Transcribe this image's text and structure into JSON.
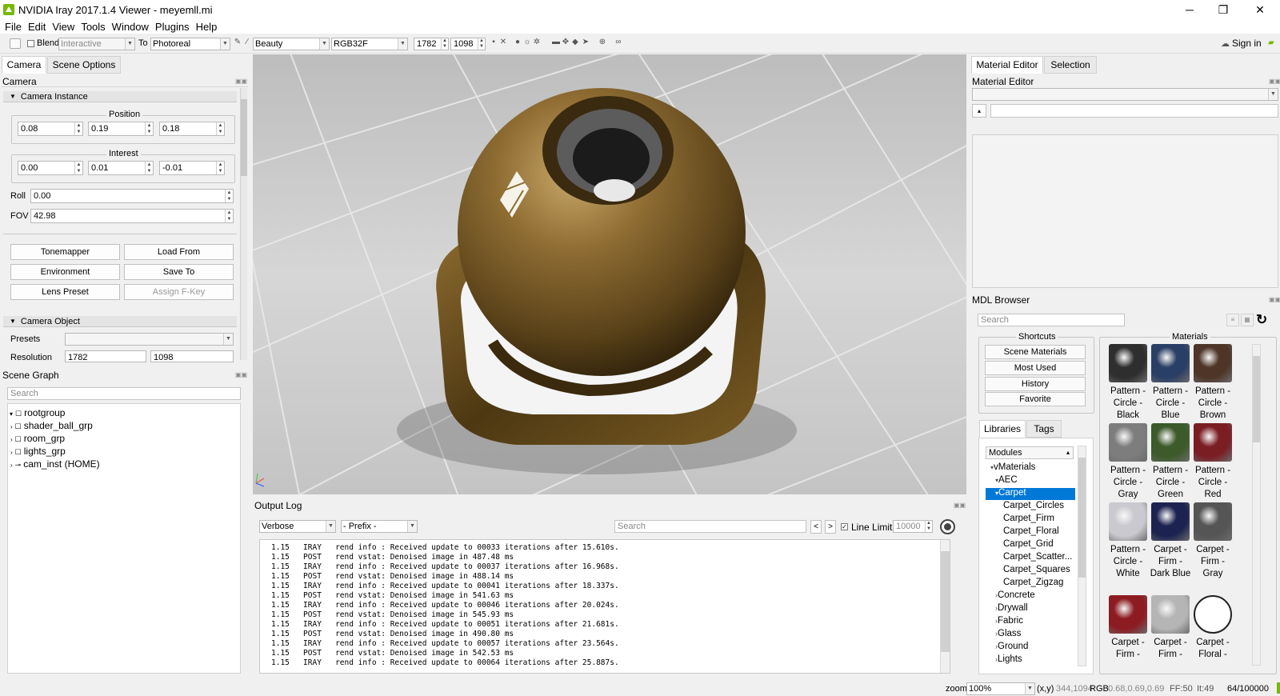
{
  "window": {
    "title": "NVIDIA Iray 2017.1.4 Viewer - meyemll.mi",
    "minimize": "─",
    "maximize": "❐",
    "close": "✕"
  },
  "menu": [
    "File",
    "Edit",
    "View",
    "Tools",
    "Window",
    "Plugins",
    "Help"
  ],
  "toolbar": {
    "blend_label": "Blend",
    "blend_mode": "Interactive",
    "to_label": "To",
    "to_mode": "Photoreal",
    "canvas": "Beauty",
    "pixel_format": "RGB32F",
    "width": "1782",
    "height": "1098",
    "sign_in": "Sign in"
  },
  "left_tabs": [
    "Camera",
    "Scene Options"
  ],
  "camera": {
    "panel_title": "Camera",
    "instance_header": "Camera Instance",
    "position_label": "Position",
    "position": [
      "0.08",
      "0.19",
      "0.18"
    ],
    "interest_label": "Interest",
    "interest": [
      "0.00",
      "0.01",
      "-0.01"
    ],
    "roll_label": "Roll",
    "roll": "0.00",
    "fov_label": "FOV",
    "fov": "42.98",
    "buttons": [
      "Tonemapper",
      "Load From",
      "Environment",
      "Save To",
      "Lens Preset",
      "Assign F-Key"
    ],
    "object_header": "Camera Object",
    "presets_label": "Presets",
    "resolution_label": "Resolution",
    "resolution": [
      "1782",
      "1098"
    ]
  },
  "scene_graph": {
    "title": "Scene Graph",
    "search_placeholder": "Search",
    "items": [
      "rootgroup",
      "shader_ball_grp",
      "room_grp",
      "lights_grp",
      "cam_inst (HOME)"
    ]
  },
  "output_log": {
    "title": "Output Log",
    "level": "Verbose",
    "prefix": "- Prefix -",
    "search_placeholder": "Search",
    "prev": "<",
    "next": ">",
    "line_limit_label": "Line Limit",
    "line_limit": "10000",
    "lines": [
      "1.15   IRAY   rend info : Received update to 00033 iterations after 15.610s.",
      "1.15   POST   rend vstat: Denoised image in 487.48 ms",
      "1.15   IRAY   rend info : Received update to 00037 iterations after 16.968s.",
      "1.15   POST   rend vstat: Denoised image in 488.14 ms",
      "1.15   IRAY   rend info : Received update to 00041 iterations after 18.337s.",
      "1.15   POST   rend vstat: Denoised image in 541.63 ms",
      "1.15   IRAY   rend info : Received update to 00046 iterations after 20.024s.",
      "1.15   POST   rend vstat: Denoised image in 545.93 ms",
      "1.15   IRAY   rend info : Received update to 00051 iterations after 21.681s.",
      "1.15   POST   rend vstat: Denoised image in 490.80 ms",
      "1.15   IRAY   rend info : Received update to 00057 iterations after 23.564s.",
      "1.15   POST   rend vstat: Denoised image in 542.53 ms",
      "1.15   IRAY   rend info : Received update to 00064 iterations after 25.887s."
    ]
  },
  "right_tabs": [
    "Material Editor",
    "Selection"
  ],
  "material_editor": {
    "title": "Material Editor",
    "expand": "▴"
  },
  "mdl_browser": {
    "title": "MDL Browser",
    "search_placeholder": "Search",
    "shortcuts_title": "Shortcuts",
    "shortcuts": [
      "Scene Materials",
      "Most Used",
      "History",
      "Favorite"
    ],
    "lib_tabs": [
      "Libraries",
      "Tags"
    ],
    "modules_label": "Modules",
    "tree": [
      {
        "text": "vMaterials",
        "arrow": "▾"
      },
      {
        "text": "AEC",
        "arrow": "▾"
      },
      {
        "text": "Carpet",
        "arrow": "▾",
        "selected": true
      },
      {
        "text": "Carpet_Circles"
      },
      {
        "text": "Carpet_Firm"
      },
      {
        "text": "Carpet_Floral"
      },
      {
        "text": "Carpet_Grid"
      },
      {
        "text": "Carpet_Scatter..."
      },
      {
        "text": "Carpet_Squares"
      },
      {
        "text": "Carpet_Zigzag"
      },
      {
        "text": "Concrete",
        "arrow": "›"
      },
      {
        "text": "Drywall",
        "arrow": "›"
      },
      {
        "text": "Fabric",
        "arrow": "›"
      },
      {
        "text": "Glass",
        "arrow": "›"
      },
      {
        "text": "Ground",
        "arrow": "›"
      },
      {
        "text": "Lights",
        "arrow": "›"
      }
    ],
    "materials_title": "Materials",
    "materials": [
      {
        "label": "Pattern - Circle - Black",
        "color": "#2e2e2e"
      },
      {
        "label": "Pattern - Circle - Blue",
        "color": "#2a3f66"
      },
      {
        "label": "Pattern - Circle - Brown",
        "color": "#4e3528"
      },
      {
        "label": "Pattern - Circle - Gray",
        "color": "#7d7d7d"
      },
      {
        "label": "Pattern - Circle - Green",
        "color": "#3c5a2a"
      },
      {
        "label": "Pattern - Circle - Red",
        "color": "#7a1e24"
      },
      {
        "label": "Pattern - Circle - White",
        "color": "#c9c9cf"
      },
      {
        "label": "Carpet - Firm - Dark Blue",
        "color": "#1c2350"
      },
      {
        "label": "Carpet - Firm - Gray",
        "color": "#555555"
      },
      {
        "label": "Carpet - Firm -",
        "color": "#8c1c22"
      },
      {
        "label": "Carpet - Firm -",
        "color": "#b5b5b5"
      },
      {
        "label": "Carpet - Floral -",
        "color": "#ffffff"
      }
    ]
  },
  "status": {
    "zoom_label": "zoom",
    "zoom": "100%",
    "xy_label": "(x,y)",
    "xy": "344,1094",
    "rgb_label": "RGB",
    "rgb": "0.68,0.69,0.69",
    "ff": "FF:50",
    "it": "It:49",
    "iter": "64/100000"
  },
  "colors": {
    "accent": "#0078d7",
    "nvidia": "#76b900",
    "brass": "#8a6a30"
  }
}
